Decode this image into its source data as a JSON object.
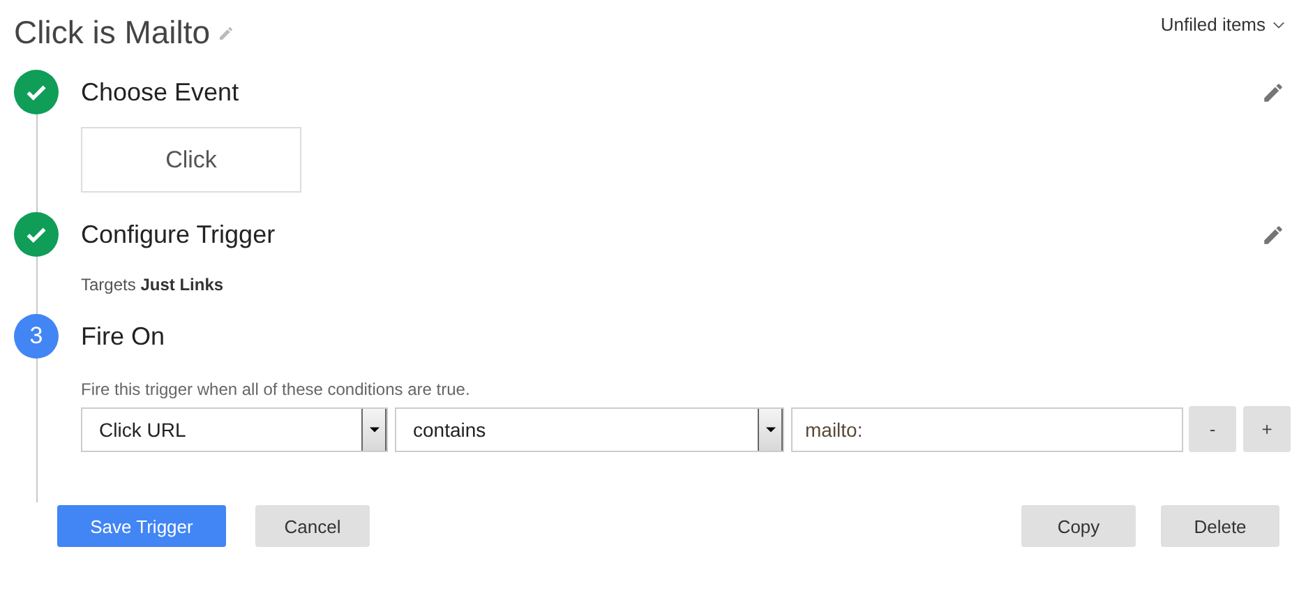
{
  "title": "Click is Mailto",
  "folder": {
    "label": "Unfiled items"
  },
  "steps": [
    {
      "kind": "done",
      "title": "Choose Event",
      "editable": true,
      "event": "Click"
    },
    {
      "kind": "done",
      "title": "Configure Trigger",
      "editable": true,
      "note": "Targets **Just Links**"
    },
    {
      "kind": "number",
      "number": "3",
      "title": "Fire On",
      "editable": false,
      "hint": "Fire this trigger when all of these conditions are true.",
      "condition": {
        "variable": "Click URL",
        "operator": "contains",
        "value": "mailto:"
      },
      "remove": "-",
      "add": "+"
    }
  ],
  "buttons": [
    {
      "label": "Save Trigger",
      "kind": "primary"
    },
    {
      "label": "Cancel",
      "kind": "secondary"
    },
    {
      "label": "Copy",
      "kind": "secondary"
    },
    {
      "label": "Delete",
      "kind": "secondary"
    }
  ]
}
